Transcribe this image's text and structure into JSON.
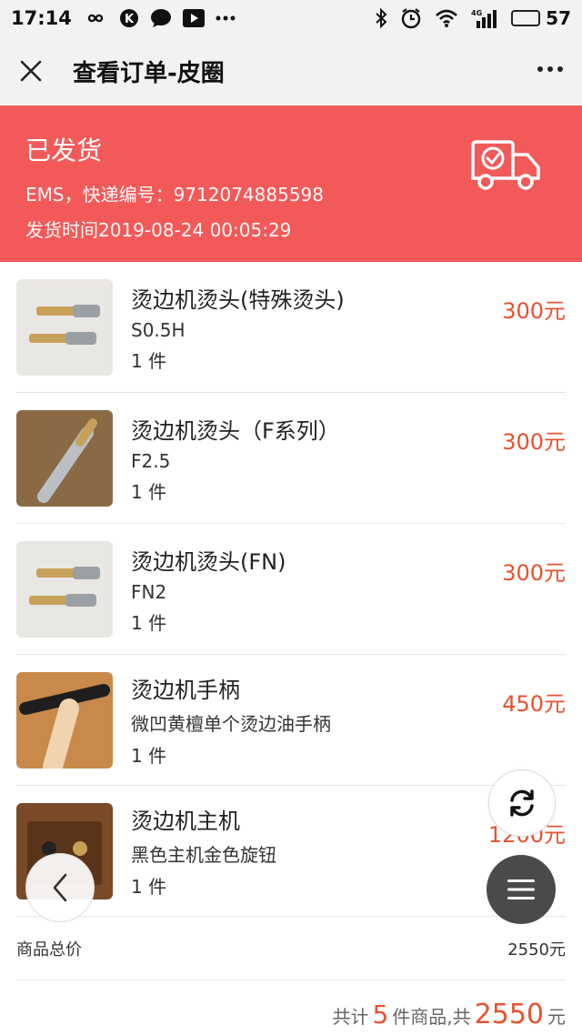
{
  "status_bar": {
    "time": "17:14",
    "network": "4G",
    "battery_percent": "57",
    "battery_level": 0.57,
    "icons": [
      "infinity-icon",
      "k-app-icon",
      "chat-bubble-icon",
      "video-play-icon",
      "more-dots-icon",
      "bluetooth-icon",
      "alarm-icon",
      "wifi-icon",
      "signal-icon",
      "battery-icon"
    ]
  },
  "header": {
    "title": "查看订单-皮圈",
    "close_icon": "close-icon",
    "more_icon": "more-horizontal-icon"
  },
  "shipping": {
    "status": "已发货",
    "carrier_line": "EMS，快递编号：9712074885598",
    "time_line": "发货时间2019-08-24 00:05:29",
    "icon": "delivery-truck-icon",
    "banner_color": "#f25a5a"
  },
  "items": [
    {
      "name": "烫边机烫头(特殊烫头)",
      "spec": "S0.5H",
      "qty": "1 件",
      "price": "300元"
    },
    {
      "name": "烫边机烫头（F系列）",
      "spec": "F2.5",
      "qty": "1 件",
      "price": "300元"
    },
    {
      "name": "烫边机烫头(FN)",
      "spec": "FN2",
      "qty": "1 件",
      "price": "300元"
    },
    {
      "name": "烫边机手柄",
      "spec": "微凹黄檀单个烫边油手柄",
      "qty": "1 件",
      "price": "450元"
    },
    {
      "name": "烫边机主机",
      "spec": "黑色主机金色旋钮",
      "qty": "1 件",
      "price": "1200元"
    }
  ],
  "totals": {
    "label": "商品总价",
    "value": "2550元"
  },
  "summary": {
    "prefix": "共计",
    "count": "5",
    "middle": "件商品,共",
    "amount": "2550",
    "suffix": "元"
  },
  "accent_color": "#e8522f"
}
